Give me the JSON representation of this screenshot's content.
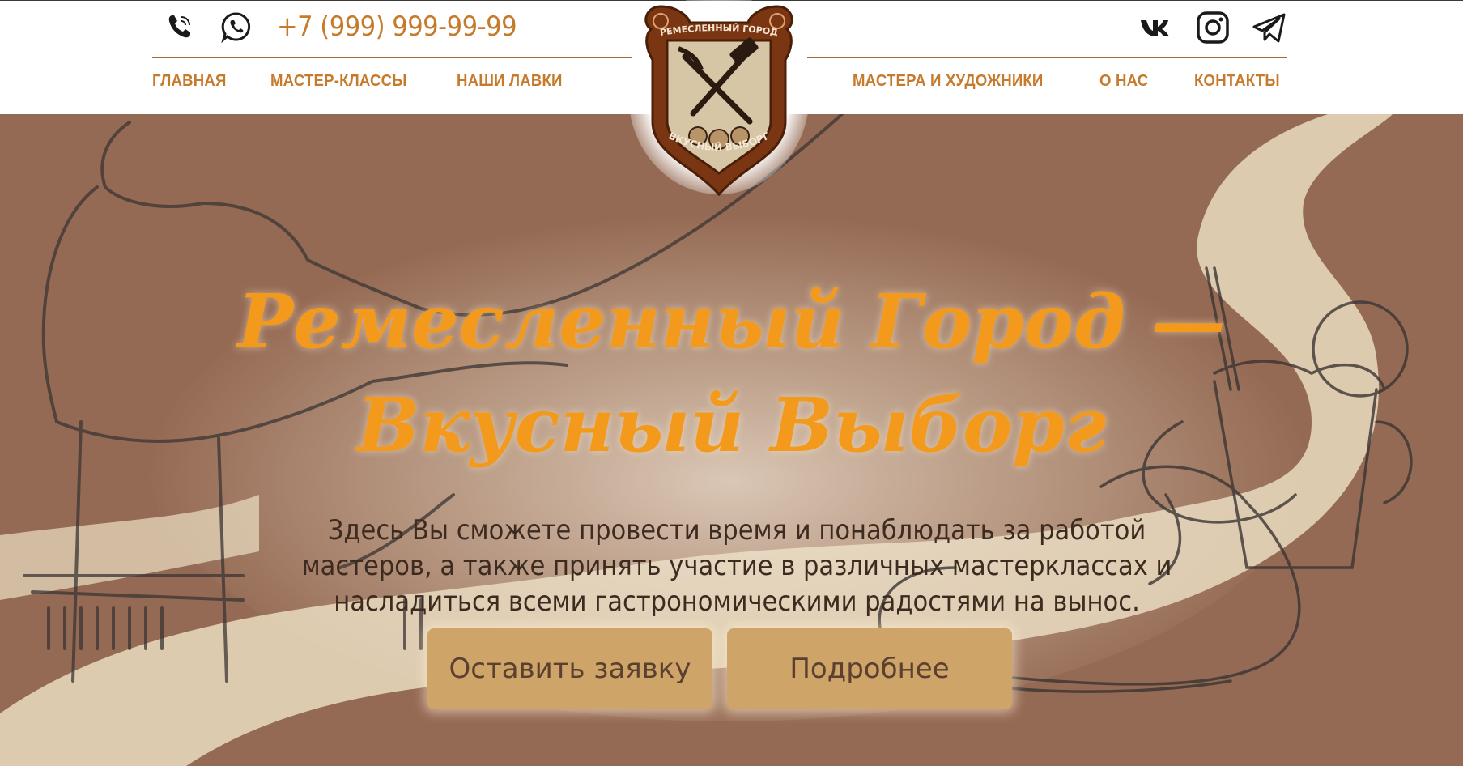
{
  "header": {
    "phone": "+7 (999) 999-99-99",
    "contact_icons": [
      "phone-icon",
      "whatsapp-icon"
    ],
    "social_icons": [
      "vk-icon",
      "instagram-icon",
      "telegram-icon"
    ],
    "nav_left": [
      {
        "label": "ГЛАВНАЯ"
      },
      {
        "label": "МАСТЕР-КЛАССЫ"
      },
      {
        "label": "НАШИ ЛАВКИ"
      }
    ],
    "nav_right": [
      {
        "label": "МАСТЕРА И ХУДОЖНИКИ"
      },
      {
        "label": "О НАС"
      },
      {
        "label": "КОНТАКТЫ"
      }
    ]
  },
  "logo": {
    "top_text": "РЕМЕСЛЕННЫЙ ГОРОД",
    "bottom_text": "ВКУСНЫЙ ВЫБОРГ"
  },
  "hero": {
    "title_line1": "Ремесленный Город —",
    "title_line2": "Вкусный Выборг",
    "description": "Здесь Вы сможете провести время и понаблюдать за работой мастеров, а также принять участие в различных мастерклассах и насладиться всеми гастрономическими радостями на вынос.",
    "button_primary": "Оставить заявку",
    "button_secondary": "Подробнее"
  },
  "colors": {
    "accent": "#c67a2c",
    "title": "#f39a1c",
    "hero_bg": "#956a54",
    "cream": "#ddcbb0",
    "button": "#cfa468",
    "logo_brown": "#7a3612"
  }
}
